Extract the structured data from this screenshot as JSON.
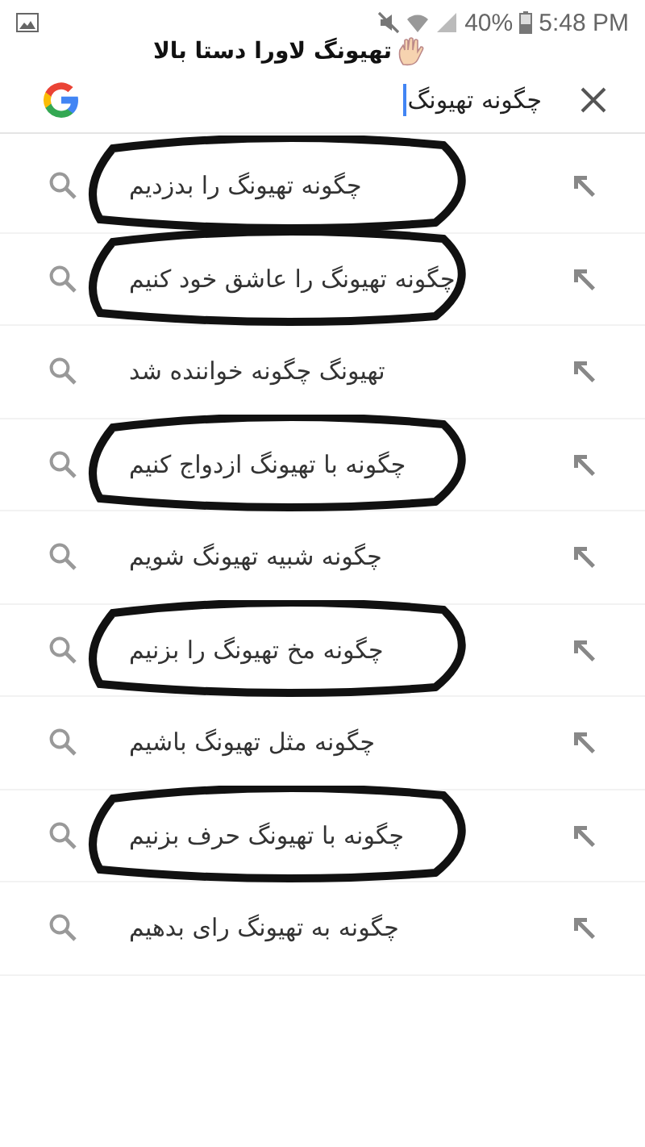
{
  "status_bar": {
    "battery": "40%",
    "time": "5:48 PM"
  },
  "caption": "تهیونگ لاورا دستا بالا",
  "search": {
    "value": "چگونه تهیونگ"
  },
  "suggestions": [
    {
      "text": "چگونه تهیونگ را بدزدیم",
      "circled": true
    },
    {
      "text": "چگونه تهیونگ را عاشق خود کنیم",
      "circled": true
    },
    {
      "text": "تهیونگ چگونه خواننده شد",
      "circled": false
    },
    {
      "text": "چگونه با تهیونگ ازدواج کنیم",
      "circled": true
    },
    {
      "text": "چگونه شبیه تهیونگ شویم",
      "circled": false
    },
    {
      "text": "چگونه مخ تهیونگ را بزنیم",
      "circled": true
    },
    {
      "text": "چگونه مثل تهیونگ باشیم",
      "circled": false
    },
    {
      "text": "چگونه با تهیونگ حرف بزنیم",
      "circled": true
    },
    {
      "text": "چگونه به تهیونگ رای بدهیم",
      "circled": false
    }
  ]
}
